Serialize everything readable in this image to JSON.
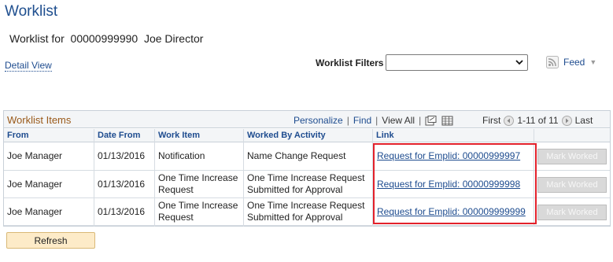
{
  "page": {
    "title": "Worklist",
    "subtitle": "Worklist for  00000999990  Joe Director",
    "detail_view": "Detail View",
    "filters_label": "Worklist Filters",
    "filters_value": "",
    "feed_label": "Feed"
  },
  "grid": {
    "title": "Worklist Items",
    "nav": {
      "personalize": "Personalize",
      "find": "Find",
      "view_all": "View All"
    },
    "pager": {
      "first": "First",
      "range": "1-11 of 11",
      "last": "Last"
    },
    "columns": [
      "From",
      "Date From",
      "Work Item",
      "Worked By Activity",
      "Link"
    ],
    "rows": [
      {
        "from": "Joe Manager",
        "date": "01/13/2016",
        "work_item": "Notification",
        "work_item_2": "",
        "activity": "Name Change Request",
        "activity_2": "",
        "link": "Request for Emplid: 00000999997",
        "button": "Mark Worked"
      },
      {
        "from": "Joe Manager",
        "date": "01/13/2016",
        "work_item": "One Time Increase",
        "work_item_2": "Request",
        "activity": "One Time Increase Request",
        "activity_2": "Submitted for Approval",
        "link": "Request for Emplid: 00000999998",
        "button": "Mark Worked"
      },
      {
        "from": "Joe Manager",
        "date": "01/13/2016",
        "work_item": "One Time Increase",
        "work_item_2": "Request",
        "activity": "One Time Increase Request",
        "activity_2": "Submitted for Approval",
        "link": "Request for Emplid: 000009999999",
        "button": "Mark Worked"
      }
    ]
  },
  "refresh_label": "Refresh",
  "colors": {
    "title_blue": "#1f4f8f",
    "link_blue": "#1e4c8f",
    "grid_title": "#9a5a1a",
    "highlight": "#e3212b",
    "refresh_bg": "#fdebc8"
  }
}
